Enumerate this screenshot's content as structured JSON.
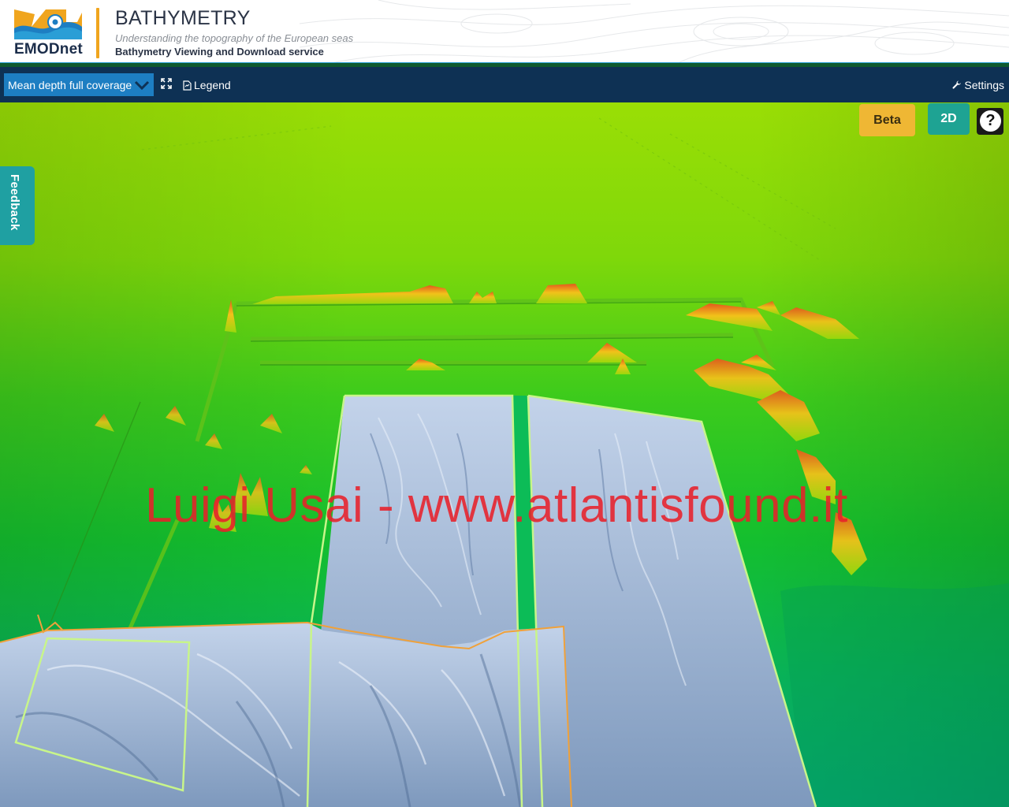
{
  "header": {
    "logo_text": "EMODnet",
    "title": "BATHYMETRY",
    "subtitle": "Understanding the topography of the European seas",
    "service": "Bathymetry Viewing and Download service"
  },
  "toolbar": {
    "layer_select": "Mean depth full coverage",
    "legend_label": "Legend",
    "settings_label": "Settings"
  },
  "map": {
    "beta_label": "Beta",
    "mode_label": "2D",
    "help_label": "?",
    "feedback_label": "Feedback",
    "watermark": "Luigi Usai - www.atlantisfound.it"
  },
  "colors": {
    "header_accent": "#f0a51e",
    "toolbar_bg": "#0e3154",
    "select_bg": "#1d7ec2",
    "beta_bg": "#efb734",
    "mode_bg": "#1ea393",
    "feedback_bg": "#1fa0a2",
    "terrain_shallow": "#9ade05",
    "terrain_deep": "#08a86e",
    "survey_fill": "#9eb6d6",
    "survey_outline": "#c8f58a",
    "boundary_line": "#f0a13a",
    "watermark": "#e8212b"
  },
  "icons": {
    "logo": "emodnet-logo-icon",
    "dropdown": "chevron-down-icon",
    "fullscreen": "expand-icon",
    "legend": "document-icon",
    "settings": "wrench-icon",
    "help": "question-icon"
  }
}
